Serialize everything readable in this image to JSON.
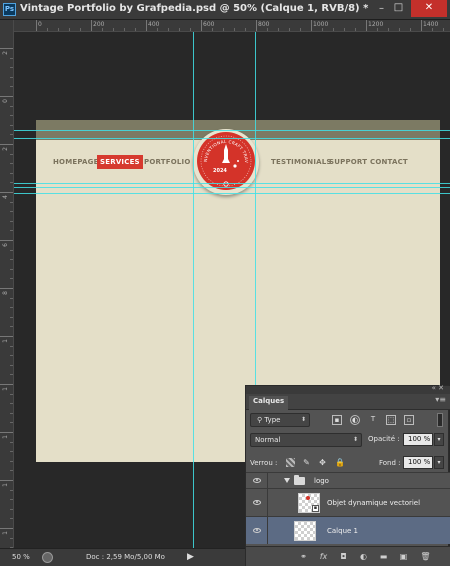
{
  "window": {
    "app_logo": "Ps",
    "title": "Vintage Portfolio by Grafpedia.psd @ 50%  (Calque 1, RVB/8) *",
    "min_icon": "minimize-icon",
    "max_icon": "maximize-icon",
    "close_icon": "close-icon",
    "min_glyph": "–",
    "max_glyph": "□",
    "close_glyph": "✕"
  },
  "rulers": {
    "h_labels": [
      "0",
      "200",
      "400",
      "600",
      "800",
      "1000",
      "1200",
      "1400"
    ],
    "v_labels": [
      "2",
      "0",
      "2",
      "4",
      "6",
      "8",
      "1",
      "1",
      "1",
      "1",
      "1"
    ]
  },
  "canvas": {
    "nav": {
      "homepage": "HOMEPAGE",
      "services": "SERVICES",
      "portfolio": "PORTFOLIO",
      "testimonials": "TESTIMONIALS",
      "support": "SUPPORT",
      "contact": "CONTACT"
    },
    "badge": {
      "arc_text": "CONVENTIONAL CRAFT TRAVEL",
      "year": "2024"
    },
    "colors": {
      "page_bg": "#e4dfc8",
      "header_strip": "#7c7a63",
      "accent_red": "#d43329",
      "guide_cyan": "#3fe0e6"
    }
  },
  "status": {
    "zoom": "50 %",
    "doc_info": "Doc : 2,59 Mo/5,00 Mo",
    "arrow": "▶"
  },
  "layers_panel": {
    "tab_label": "Calques",
    "filter_kind": "Type",
    "blend_mode": "Normal",
    "opacity_label": "Opacité :",
    "opacity_value": "100 %",
    "lock_label": "Verrou :",
    "fill_label": "Fond :",
    "fill_value": "100 %",
    "layers": [
      {
        "name": "logo",
        "type": "group"
      },
      {
        "name": "Objet dynamique vectoriel",
        "type": "smart-object"
      },
      {
        "name": "Calque 1",
        "type": "layer",
        "selected": true
      }
    ],
    "footer_icons": [
      "link-icon",
      "fx-icon",
      "mask-icon",
      "adjustment-icon",
      "group-folder-icon",
      "new-layer-icon",
      "trash-icon"
    ],
    "footer_glyphs": [
      "⚭",
      "fx",
      "◘",
      "◐",
      "▬",
      "▣",
      "🗑"
    ]
  }
}
